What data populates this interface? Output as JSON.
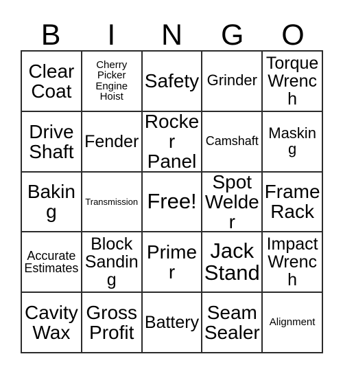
{
  "card": {
    "type": "bingo-card",
    "title_letters": [
      "B",
      "I",
      "N",
      "G",
      "O"
    ],
    "columns": 5,
    "rows": 5,
    "colors": {
      "background": "#ffffff",
      "border": "#2b2b2b",
      "text": "#000000"
    },
    "free_space": {
      "label": "Free!",
      "row": 3,
      "column": 3
    }
  },
  "header": {
    "b": "B",
    "i": "I",
    "n": "N",
    "g": "G",
    "o": "O"
  },
  "grid": {
    "rows": [
      {
        "cells": [
          {
            "text": "Clear Coat",
            "size": "fs-xl"
          },
          {
            "text": "Cherry Picker Engine Hoist",
            "size": "fs-xs"
          },
          {
            "text": "Safety",
            "size": "fs-xl"
          },
          {
            "text": "Grinder",
            "size": "fs-md"
          },
          {
            "text": "Torque Wrench",
            "size": "fs-lg"
          }
        ]
      },
      {
        "cells": [
          {
            "text": "Drive Shaft",
            "size": "fs-xl"
          },
          {
            "text": "Fender",
            "size": "fs-lg"
          },
          {
            "text": "Rocker Panel",
            "size": "fs-xl"
          },
          {
            "text": "Camshaft",
            "size": "fs-sm"
          },
          {
            "text": "Masking",
            "size": "fs-md"
          }
        ]
      },
      {
        "cells": [
          {
            "text": "Baking",
            "size": "fs-xl"
          },
          {
            "text": "Transmission",
            "size": "fs-xxs"
          },
          {
            "text": "Free!",
            "size": "fs-xxl"
          },
          {
            "text": "Spot Welder",
            "size": "fs-xl"
          },
          {
            "text": "Frame Rack",
            "size": "fs-xl"
          }
        ]
      },
      {
        "cells": [
          {
            "text": "Accurate Estimates",
            "size": "fs-sm"
          },
          {
            "text": "Block Sanding",
            "size": "fs-lg"
          },
          {
            "text": "Primer",
            "size": "fs-xl"
          },
          {
            "text": "Jack Stand",
            "size": "fs-xxl"
          },
          {
            "text": "Impact Wrench",
            "size": "fs-lg"
          }
        ]
      },
      {
        "cells": [
          {
            "text": "Cavity Wax",
            "size": "fs-xl"
          },
          {
            "text": "Gross Profit",
            "size": "fs-xl"
          },
          {
            "text": "Battery",
            "size": "fs-lg"
          },
          {
            "text": "Seam Sealer",
            "size": "fs-xl"
          },
          {
            "text": "Alignment",
            "size": "fs-xs"
          }
        ]
      }
    ]
  }
}
